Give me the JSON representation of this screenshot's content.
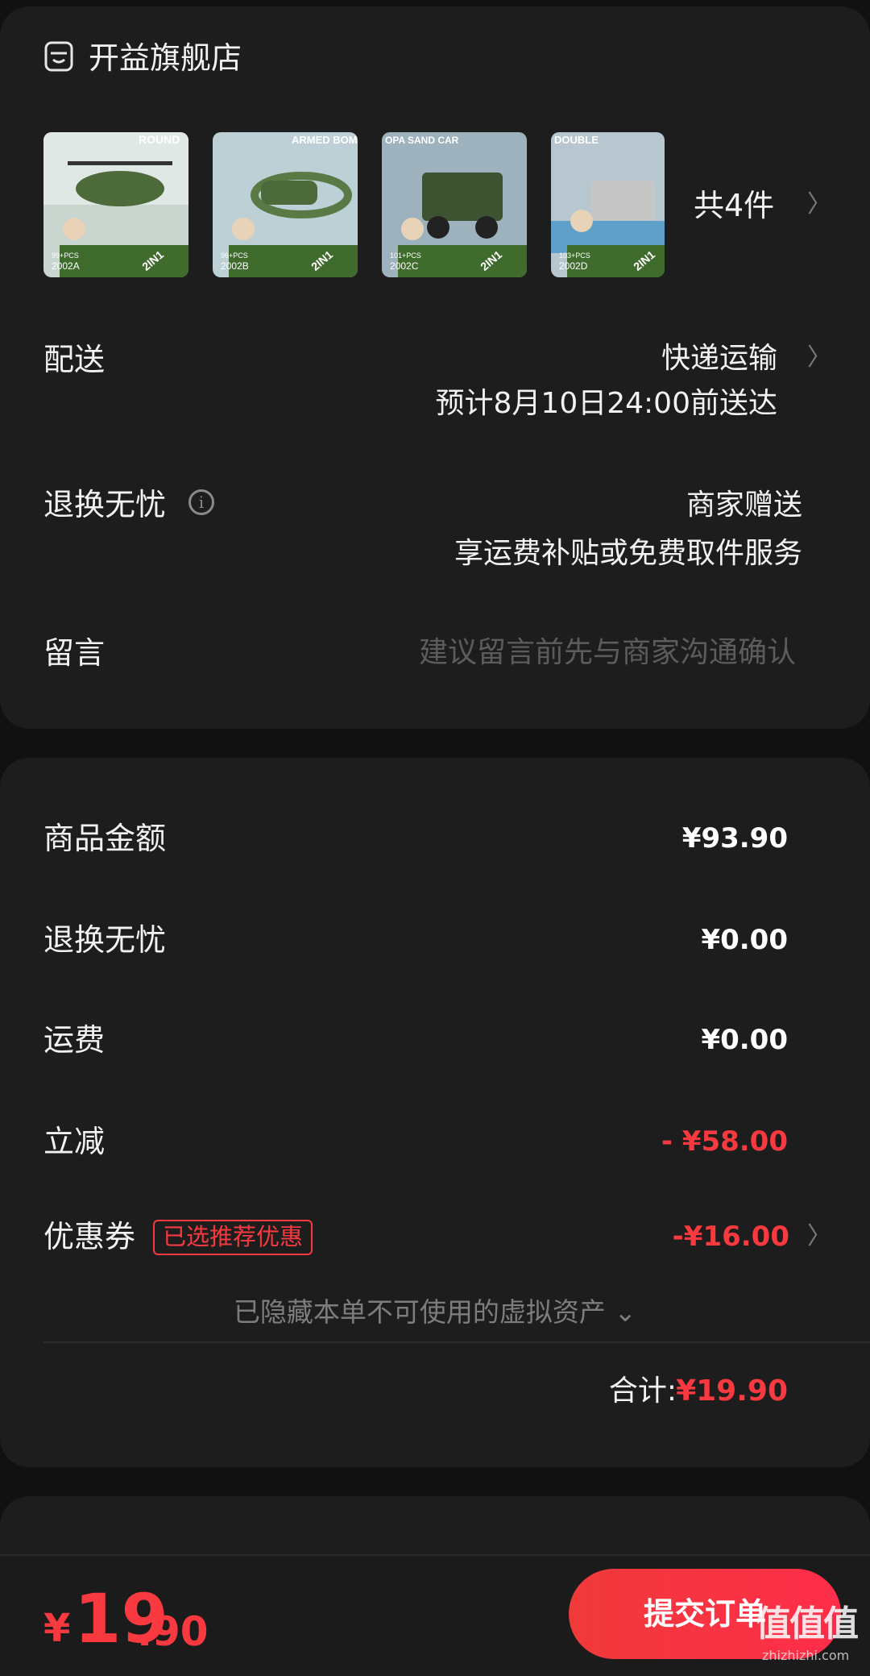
{
  "store": {
    "name": "开益旗舰店"
  },
  "products": {
    "thumbnails": [
      {
        "title": "ROUND",
        "code": "2002A",
        "pcs": "99+PCS",
        "badge": "2IN1"
      },
      {
        "title": "ARMED BOMBER",
        "code": "2002B",
        "pcs": "96+PCS",
        "badge": "2IN1"
      },
      {
        "title": "OPA SAND CAR",
        "code": "2002C",
        "pcs": "101+PCS",
        "badge": "2IN1"
      },
      {
        "title": "DOUBLE",
        "code": "2002D",
        "pcs": "103+PCS",
        "badge": "2IN1"
      }
    ],
    "count_label": "共4件"
  },
  "delivery": {
    "label": "配送",
    "method": "快递运输",
    "estimate": "预计8月10日24:00前送达"
  },
  "return_service": {
    "label": "退换无忧",
    "value": "商家赠送",
    "desc": "享运费补贴或免费取件服务"
  },
  "message": {
    "label": "留言",
    "placeholder": "建议留言前先与商家沟通确认"
  },
  "summary": {
    "goods_label": "商品金额",
    "goods_value": "¥93.90",
    "return_label": "退换无忧",
    "return_value": "¥0.00",
    "shipping_label": "运费",
    "shipping_value": "¥0.00",
    "discount_label": "立减",
    "discount_value": "- ¥58.00",
    "coupon_label": "优惠券",
    "coupon_tag": "已选推荐优惠",
    "coupon_value": "-¥16.00",
    "hidden_assets": "已隐藏本单不可使用的虚拟资产 ⌄",
    "total_label": "合计:",
    "total_value": "¥19.90"
  },
  "bottom": {
    "currency": "¥",
    "price_int": "19",
    "price_dec": ".90",
    "submit_label": "提交订单"
  },
  "watermark": {
    "logo": "值值值",
    "url": "zhizhizhi.com"
  },
  "colors": {
    "accent_red": "#f8393f",
    "card_bg": "#1d1d1d",
    "page_bg": "#111111"
  }
}
